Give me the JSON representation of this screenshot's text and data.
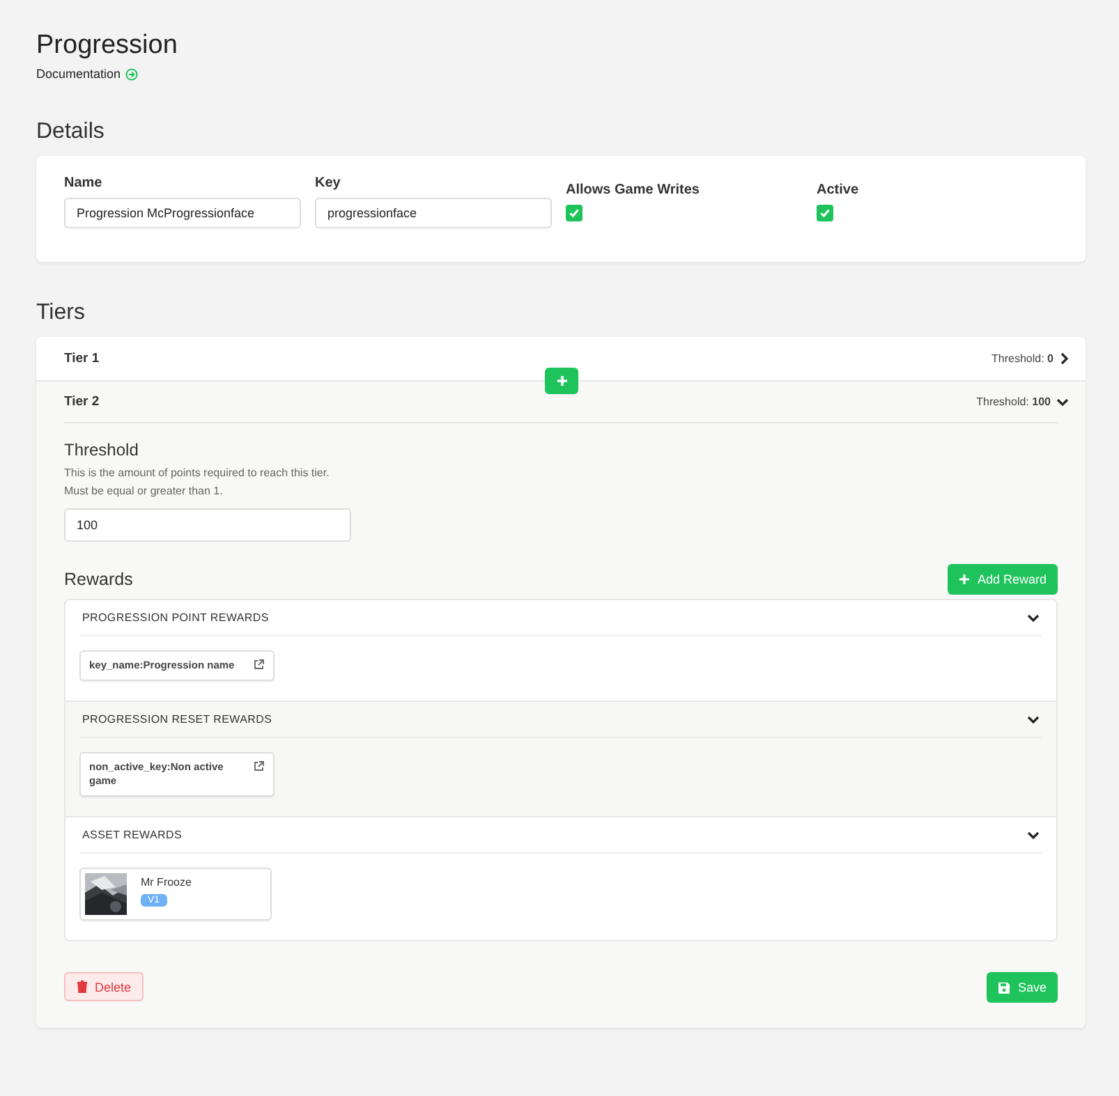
{
  "page": {
    "title": "Progression",
    "doc_link": "Documentation"
  },
  "details": {
    "heading": "Details",
    "fields": [
      {
        "label": "Name",
        "value": "Progression McProgressionface"
      },
      {
        "label": "Key",
        "value": "progressionface"
      }
    ],
    "checkboxes": [
      {
        "label": "Allows Game Writes",
        "checked": true
      },
      {
        "label": "Active",
        "checked": true
      }
    ]
  },
  "tiers": {
    "heading": "Tiers",
    "items": [
      {
        "name": "Tier 1",
        "threshold": "Threshold: **0**",
        "expanded": false
      },
      {
        "name": "Tier 2",
        "threshold": "Threshold: **100**",
        "expanded": true
      }
    ],
    "editor": {
      "threshold_label": "Threshold",
      "help": [
        "This is the amount of points required to reach this tier.",
        "Must be equal or greater than 1."
      ],
      "threshold_value": "100",
      "rewards_heading": "Rewards",
      "add_reward": "Add Reward",
      "groups": [
        {
          "title": "PROGRESSION POINT REWARDS",
          "expanded": true,
          "items": [
            {
              "kind": "link",
              "text": "key_name:Progression name"
            }
          ]
        },
        {
          "title": "PROGRESSION RESET REWARDS",
          "expanded": true,
          "items": [
            {
              "kind": "link",
              "text": "non_active_key:Non active game"
            }
          ]
        },
        {
          "title": "ASSET REWARDS",
          "expanded": true,
          "items": [
            {
              "kind": "asset",
              "text": "Mr Frooze",
              "version": "V1"
            }
          ]
        }
      ],
      "delete": "Delete",
      "save": "Save"
    }
  }
}
